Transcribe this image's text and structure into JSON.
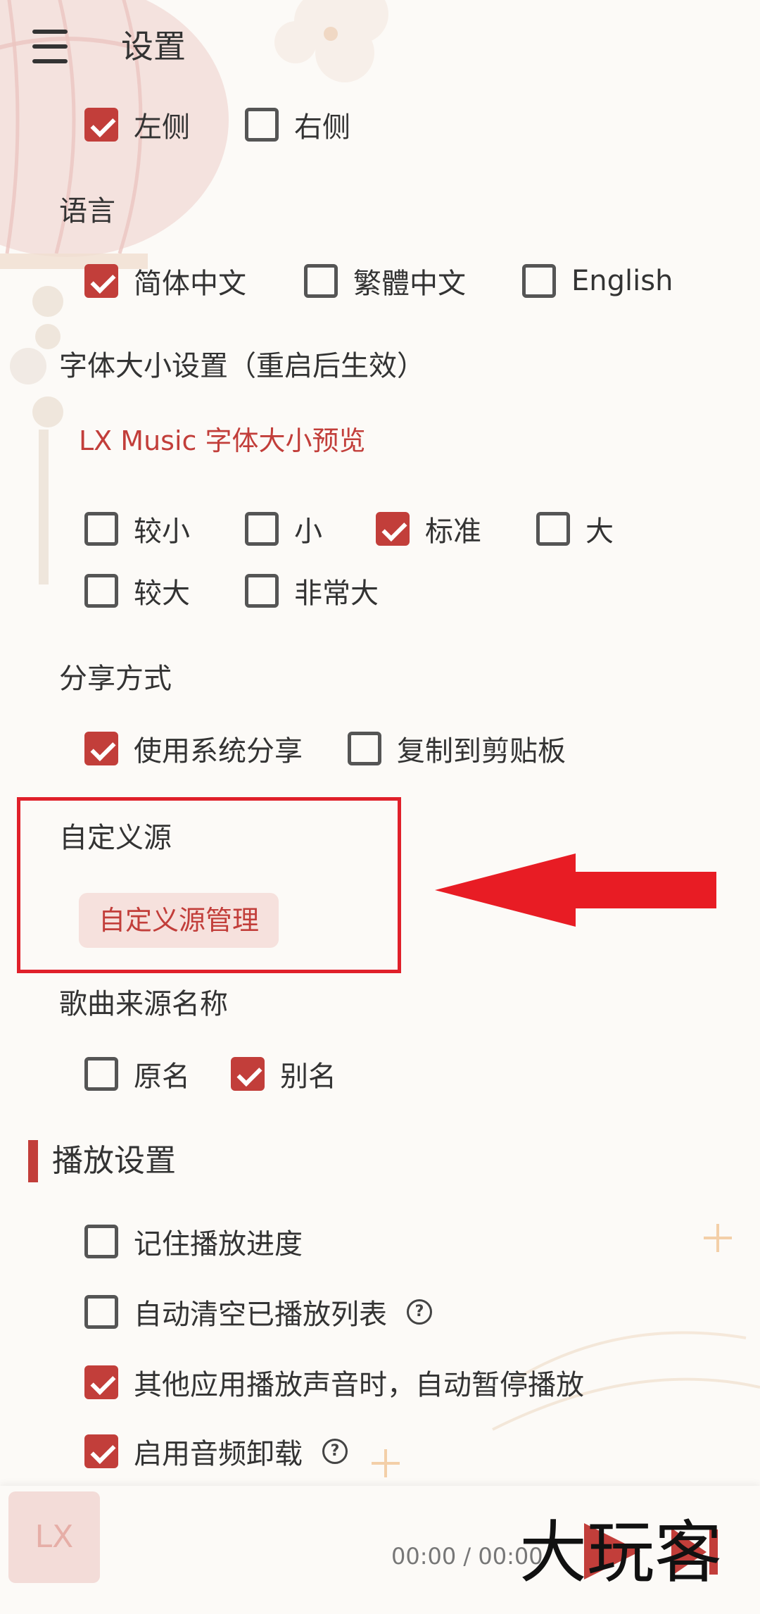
{
  "header": {
    "title": "设置",
    "menu_icon": "hamburger-menu-icon"
  },
  "position_options": [
    {
      "label": "左侧",
      "checked": true
    },
    {
      "label": "右侧",
      "checked": false
    }
  ],
  "language": {
    "label": "语言",
    "options": [
      {
        "label": "简体中文",
        "checked": true
      },
      {
        "label": "繁體中文",
        "checked": false
      },
      {
        "label": "English",
        "checked": false
      }
    ]
  },
  "font_size": {
    "label": "字体大小设置（重启后生效）",
    "preview": "LX Music 字体大小预览",
    "options": [
      {
        "label": "较小",
        "checked": false
      },
      {
        "label": "小",
        "checked": false
      },
      {
        "label": "标准",
        "checked": true
      },
      {
        "label": "大",
        "checked": false
      },
      {
        "label": "较大",
        "checked": false
      },
      {
        "label": "非常大",
        "checked": false
      }
    ]
  },
  "share": {
    "label": "分享方式",
    "options": [
      {
        "label": "使用系统分享",
        "checked": true
      },
      {
        "label": "复制到剪贴板",
        "checked": false
      }
    ]
  },
  "custom_source": {
    "label": "自定义源",
    "button": "自定义源管理"
  },
  "song_source_name": {
    "label": "歌曲来源名称",
    "options": [
      {
        "label": "原名",
        "checked": false
      },
      {
        "label": "别名",
        "checked": true
      }
    ]
  },
  "playback": {
    "title": "播放设置",
    "options": [
      {
        "label": "记住播放进度",
        "checked": false,
        "help": false
      },
      {
        "label": "自动清空已播放列表",
        "checked": false,
        "help": true
      },
      {
        "label": "其他应用播放声音时，自动暂停播放",
        "checked": true,
        "help": false
      },
      {
        "label": "启用音频卸载",
        "checked": true,
        "help": true
      }
    ],
    "help_glyph": "?"
  },
  "player": {
    "album_text": "LX",
    "time": "00:00 / 00:00"
  },
  "watermark": "大玩客",
  "colors": {
    "accent": "#c23e3a",
    "highlight": "#e0202a",
    "background": "#fcfaf7"
  }
}
